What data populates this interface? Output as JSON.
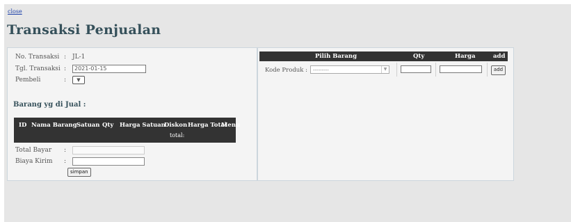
{
  "top": {
    "close_link": "close"
  },
  "page": {
    "title": "Transaksi Penjualan"
  },
  "form": {
    "no_transaksi_label": "No. Transaksi",
    "no_transaksi_value": "JL-1",
    "tgl_transaksi_label": "Tgl. Transaksi",
    "tgl_transaksi_value": "2021-01-15",
    "pembeli_label": "Pembeli",
    "colon": ":"
  },
  "items": {
    "section_title": "Barang yg di Jual :",
    "columns": [
      "ID",
      "Nama Barang",
      "Satuan",
      "Qty",
      "Harga Satuan",
      "Diskon",
      "Harga Total",
      "Menu"
    ],
    "total_label": "total:"
  },
  "totals": {
    "total_bayar_label": "Total Bayar",
    "biaya_kirim_label": "Biaya Kirim",
    "simpan_button": "simpan"
  },
  "picker": {
    "columns": [
      "Pilih Barang",
      "Qty",
      "Harga",
      "add"
    ],
    "kode_produk_label": "Kode Produk :",
    "kode_produk_placeholder": "---------",
    "add_button": "add"
  },
  "icons": {
    "select_arrow": "chevron-down-icon"
  }
}
